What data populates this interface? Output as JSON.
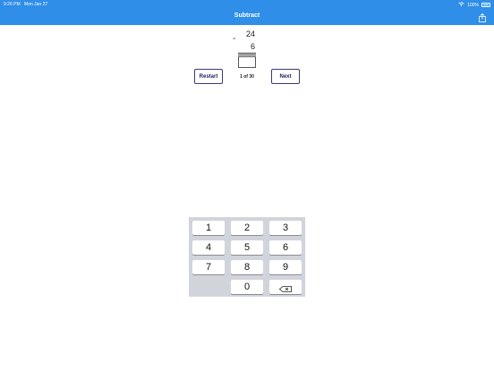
{
  "status_bar": {
    "time": "9:26 PM",
    "date": "Mon Jan 27",
    "battery": "100%"
  },
  "header": {
    "title": "Subtract"
  },
  "problem": {
    "operator": "-",
    "top": "24",
    "bottom": "6",
    "answer": ""
  },
  "controls": {
    "restart_label": "Restart",
    "next_label": "Next",
    "progress": "1 of 30"
  },
  "keypad": {
    "keys": [
      "1",
      "2",
      "3",
      "4",
      "5",
      "6",
      "7",
      "8",
      "9",
      "0"
    ],
    "backspace_icon": "backspace-icon"
  },
  "colors": {
    "header": "#2f8ee8",
    "keypad_bg": "#d1d4db",
    "button_border": "#3a3a7a"
  }
}
